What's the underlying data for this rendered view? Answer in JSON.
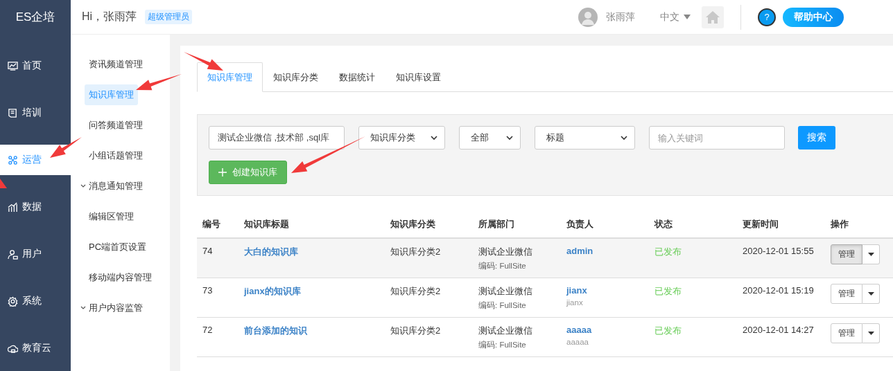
{
  "header": {
    "logo": "ES企培",
    "greeting": "Hi，张雨萍",
    "role_badge": "超级管理员",
    "user_name": "张雨萍",
    "language": "中文",
    "help_icon_text": "?",
    "help_label": "帮助中心"
  },
  "nav": [
    {
      "label": "首页",
      "selected": false
    },
    {
      "label": "培训",
      "selected": false
    },
    {
      "label": "运营",
      "selected": true
    },
    {
      "label": "数据",
      "selected": false
    },
    {
      "label": "用户",
      "selected": false
    },
    {
      "label": "系统",
      "selected": false
    },
    {
      "label": "教育云",
      "selected": false
    }
  ],
  "submenu": [
    {
      "label": "资讯频道管理",
      "kind": "link",
      "selected": false
    },
    {
      "label": "知识库管理",
      "kind": "link",
      "selected": true
    },
    {
      "label": "问答频道管理",
      "kind": "link",
      "selected": false
    },
    {
      "label": "小组话题管理",
      "kind": "link",
      "selected": false
    },
    {
      "label": "消息通知管理",
      "kind": "group",
      "selected": false
    },
    {
      "label": "编辑区管理",
      "kind": "link",
      "selected": false
    },
    {
      "label": "PC端首页设置",
      "kind": "link",
      "selected": false
    },
    {
      "label": "移动端内容管理",
      "kind": "link",
      "selected": false
    },
    {
      "label": "用户内容监管",
      "kind": "group",
      "selected": false
    }
  ],
  "tabs": [
    {
      "label": "知识库管理",
      "selected": true
    },
    {
      "label": "知识库分类",
      "selected": false
    },
    {
      "label": "数据统计",
      "selected": false
    },
    {
      "label": "知识库设置",
      "selected": false
    }
  ],
  "filters": {
    "department_value": "测试企业微信 ,技术部 ,sql库",
    "category_select": "知识库分类",
    "status_select": "全部",
    "field_select": "标题",
    "keyword_placeholder": "输入关键词",
    "search_button": "搜索",
    "create_button": "创建知识库"
  },
  "table": {
    "columns": [
      "编号",
      "知识库标题",
      "知识库分类",
      "所属部门",
      "负责人",
      "状态",
      "更新时间",
      "操作"
    ],
    "rows": [
      {
        "id": "74",
        "title": "大白的知识库",
        "category": "知识库分类2",
        "department": "测试企业微信",
        "department_code": "编码: FullSite",
        "owner": "admin",
        "status": "已发布",
        "updated": "2020-12-01 15:55",
        "action": "管理",
        "selected": true
      },
      {
        "id": "73",
        "title": "jianx的知识库",
        "category": "知识库分类2",
        "department": "测试企业微信",
        "department_code": "编码: FullSite",
        "owner": "jianx",
        "owner_login": "jianx",
        "status": "已发布",
        "updated": "2020-12-01 15:19",
        "action": "管理",
        "selected": false
      },
      {
        "id": "72",
        "title": "前台添加的知识",
        "category": "知识库分类2",
        "department": "测试企业微信",
        "department_code": "编码: FullSite",
        "owner": "aaaaa",
        "owner_login": "aaaaa",
        "status": "已发布",
        "updated": "2020-12-01 14:27",
        "action": "管理",
        "selected": false
      }
    ]
  }
}
